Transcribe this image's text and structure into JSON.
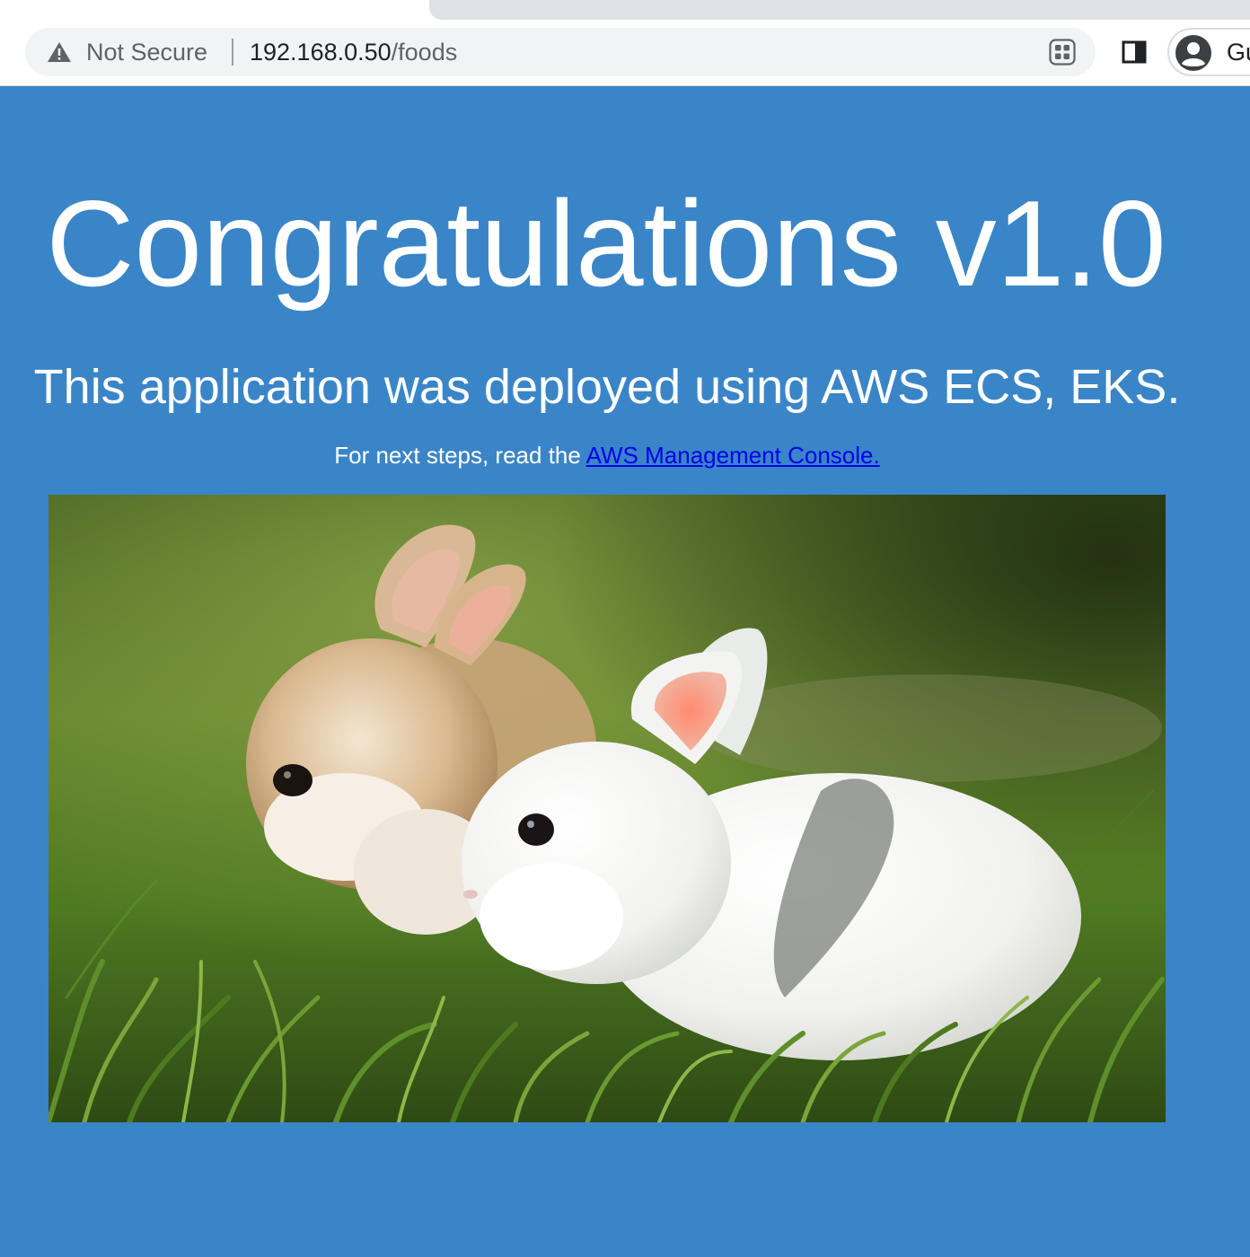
{
  "browser": {
    "security_label": "Not Secure",
    "url_host": "192.168.0.50",
    "url_path": "/foods",
    "profile_name": "Gu"
  },
  "page": {
    "headline": "Congratulations v1.0",
    "subheadline": "This application was deployed using AWS ECS, EKS.",
    "next_steps_prefix": "For next steps, read the ",
    "console_link_text": "AWS Management Console.",
    "background_color": "#3a85c7",
    "link_color": "#0000ee"
  },
  "image": {
    "subject": "two baby rabbits in grass"
  }
}
